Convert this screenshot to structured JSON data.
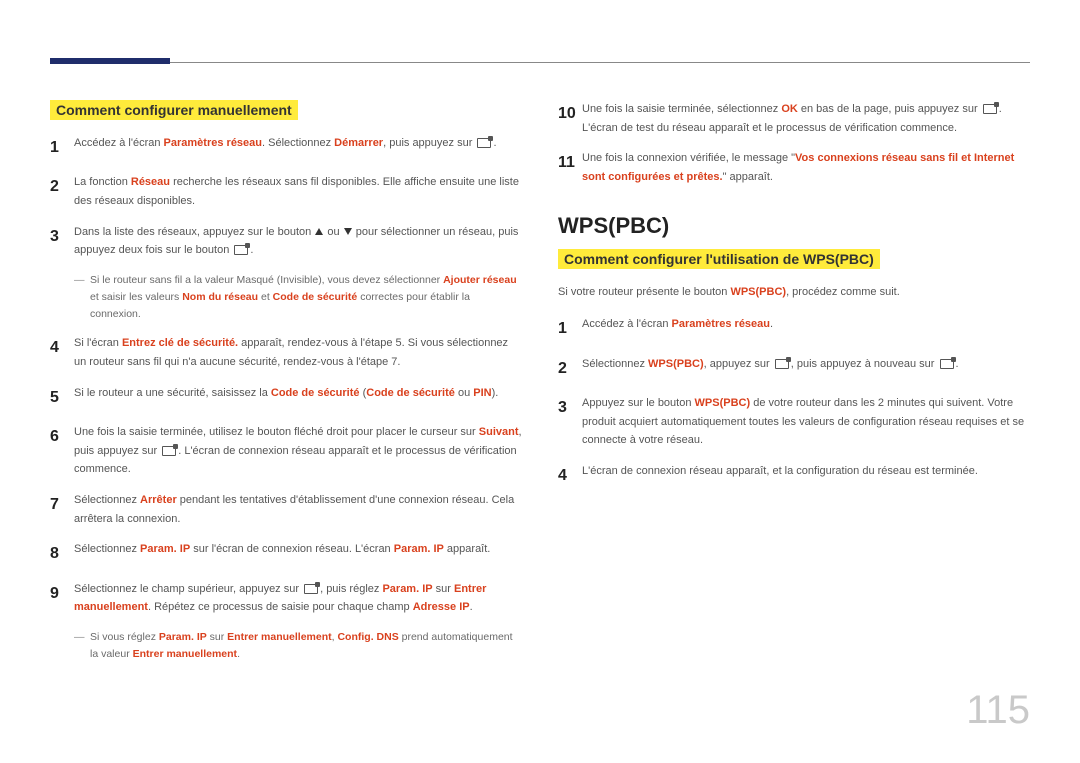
{
  "page_number": "115",
  "left": {
    "heading": "Comment configurer manuellement",
    "steps": [
      {
        "n": "1",
        "pre": "Accédez à l'écran ",
        "hl1": "Paramètres réseau",
        "mid": ". Sélectionnez ",
        "hl2": "Démarrer",
        "post": ", puis appuyez sur "
      },
      {
        "n": "2",
        "pre": "La fonction ",
        "hl1": "Réseau",
        "post": " recherche les réseaux sans fil disponibles. Elle affiche ensuite une liste des réseaux disponibles."
      },
      {
        "n": "3",
        "pre": "Dans la liste des réseaux, appuyez sur le bouton ",
        "post_after_arrows": " pour sélectionner un réseau, puis appuyez deux fois sur le bouton "
      },
      {
        "n": "4",
        "pre": "Si l'écran ",
        "hl1": "Entrez clé de sécurité.",
        "post": " apparaît, rendez-vous à l'étape 5. Si vous sélectionnez un routeur sans fil qui n'a aucune sécurité, rendez-vous à l'étape 7."
      },
      {
        "n": "5",
        "pre": "Si le routeur a une sécurité, saisissez la ",
        "hl1": "Code de sécurité",
        "mid": " (",
        "hl2": "Code de sécurité",
        "mid2": " ou ",
        "hl3": "PIN",
        "post": ")."
      },
      {
        "n": "6",
        "pre": "Une fois la saisie terminée, utilisez le bouton fléché droit pour placer le curseur sur ",
        "hl1": "Suivant",
        "mid": ", puis appuyez sur ",
        "post_after_icon": ". L'écran de connexion réseau apparaît et le processus de vérification commence."
      },
      {
        "n": "7",
        "pre": "Sélectionnez ",
        "hl1": "Arrêter",
        "post": " pendant les tentatives d'établissement d'une connexion réseau. Cela arrêtera la connexion."
      },
      {
        "n": "8",
        "pre": "Sélectionnez ",
        "hl1": "Param. IP",
        "mid": " sur l'écran de connexion réseau. L'écran ",
        "hl2": "Param. IP",
        "post": " apparaît."
      },
      {
        "n": "9",
        "pre": "Sélectionnez le champ supérieur, appuyez sur ",
        "mid_after_icon": ", puis réglez ",
        "hl1": "Param. IP",
        "mid2": " sur ",
        "hl2": "Entrer manuellement",
        "post": ". Répétez ce processus de saisie pour chaque champ ",
        "hl3": "Adresse IP",
        "post2": "."
      }
    ],
    "note3": {
      "pre": "Si le routeur sans fil a la valeur Masqué (Invisible), vous devez sélectionner ",
      "hl1": "Ajouter réseau",
      "mid": " et saisir les valeurs ",
      "hl2": "Nom du réseau",
      "mid2": " et ",
      "hl3": "Code de sécurité",
      "post": " correctes pour établir la connexion."
    },
    "note9": {
      "pre": "Si vous réglez ",
      "hl1": "Param. IP",
      "mid": " sur ",
      "hl2": "Entrer manuellement",
      "mid2": ", ",
      "hl3": "Config. DNS",
      "mid3": " prend automatiquement la valeur ",
      "hl4": "Entrer manuellement",
      "post": "."
    }
  },
  "right_top": {
    "steps": [
      {
        "n": "10",
        "pre": "Une fois la saisie terminée, sélectionnez ",
        "hl1": "OK",
        "mid": " en bas de la page, puis appuyez sur ",
        "post_after_icon": ". L'écran de test du réseau apparaît et le processus de vérification commence."
      },
      {
        "n": "11",
        "pre": "Une fois la connexion vérifiée, le message \"",
        "hl1": "Vos connexions réseau sans fil et Internet sont configurées et prêtes.",
        "post": "\" apparaît."
      }
    ]
  },
  "right_bottom": {
    "section": "WPS(PBC)",
    "heading": "Comment configurer l'utilisation de WPS(PBC)",
    "intro_pre": "Si votre routeur présente le bouton ",
    "intro_hl": "WPS(PBC)",
    "intro_post": ", procédez comme suit.",
    "steps": [
      {
        "n": "1",
        "pre": "Accédez à l'écran ",
        "hl1": "Paramètres réseau",
        "post": "."
      },
      {
        "n": "2",
        "pre": "Sélectionnez ",
        "hl1": "WPS(PBC)",
        "mid": ", appuyez sur ",
        "mid_after_icon": ", puis appuyez à nouveau sur "
      },
      {
        "n": "3",
        "pre": "Appuyez sur le bouton ",
        "hl1": "WPS(PBC)",
        "post": " de votre routeur dans les 2 minutes qui suivent. Votre produit acquiert automatiquement toutes les valeurs de configuration réseau requises et se connecte à votre réseau."
      },
      {
        "n": "4",
        "pre": "L'écran de connexion réseau apparaît, et la configuration du réseau est terminée."
      }
    ]
  }
}
